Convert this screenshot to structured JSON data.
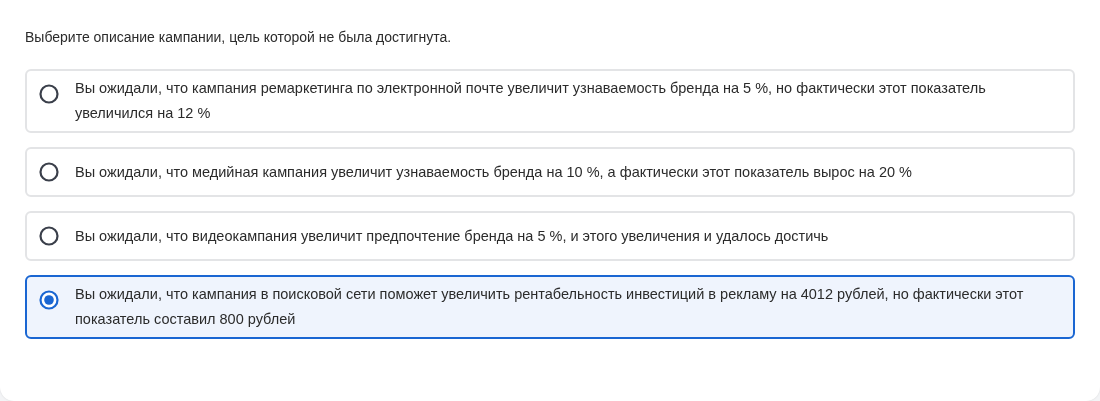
{
  "question": "Выберите описание кампании, цель которой не была достигнута.",
  "options": [
    {
      "label": "Вы ожидали, что кампания ремаркетинга по электронной почте увеличит узнаваемость бренда на 5 %, но фактически этот показатель увеличился на 12 %",
      "selected": false
    },
    {
      "label": "Вы ожидали, что медийная кампания увеличит узнаваемость бренда на 10 %, а фактически этот показатель вырос на 20 %",
      "selected": false
    },
    {
      "label": "Вы ожидали, что видеокампания увеличит предпочтение бренда на 5 %, и этого увеличения и удалось достичь",
      "selected": false
    },
    {
      "label": "Вы ожидали, что кампания в поисковой сети поможет увеличить рентабельность инвестиций в рекламу на 4012 рублей, но фактически этот показатель составил 800 рублей",
      "selected": true
    }
  ]
}
